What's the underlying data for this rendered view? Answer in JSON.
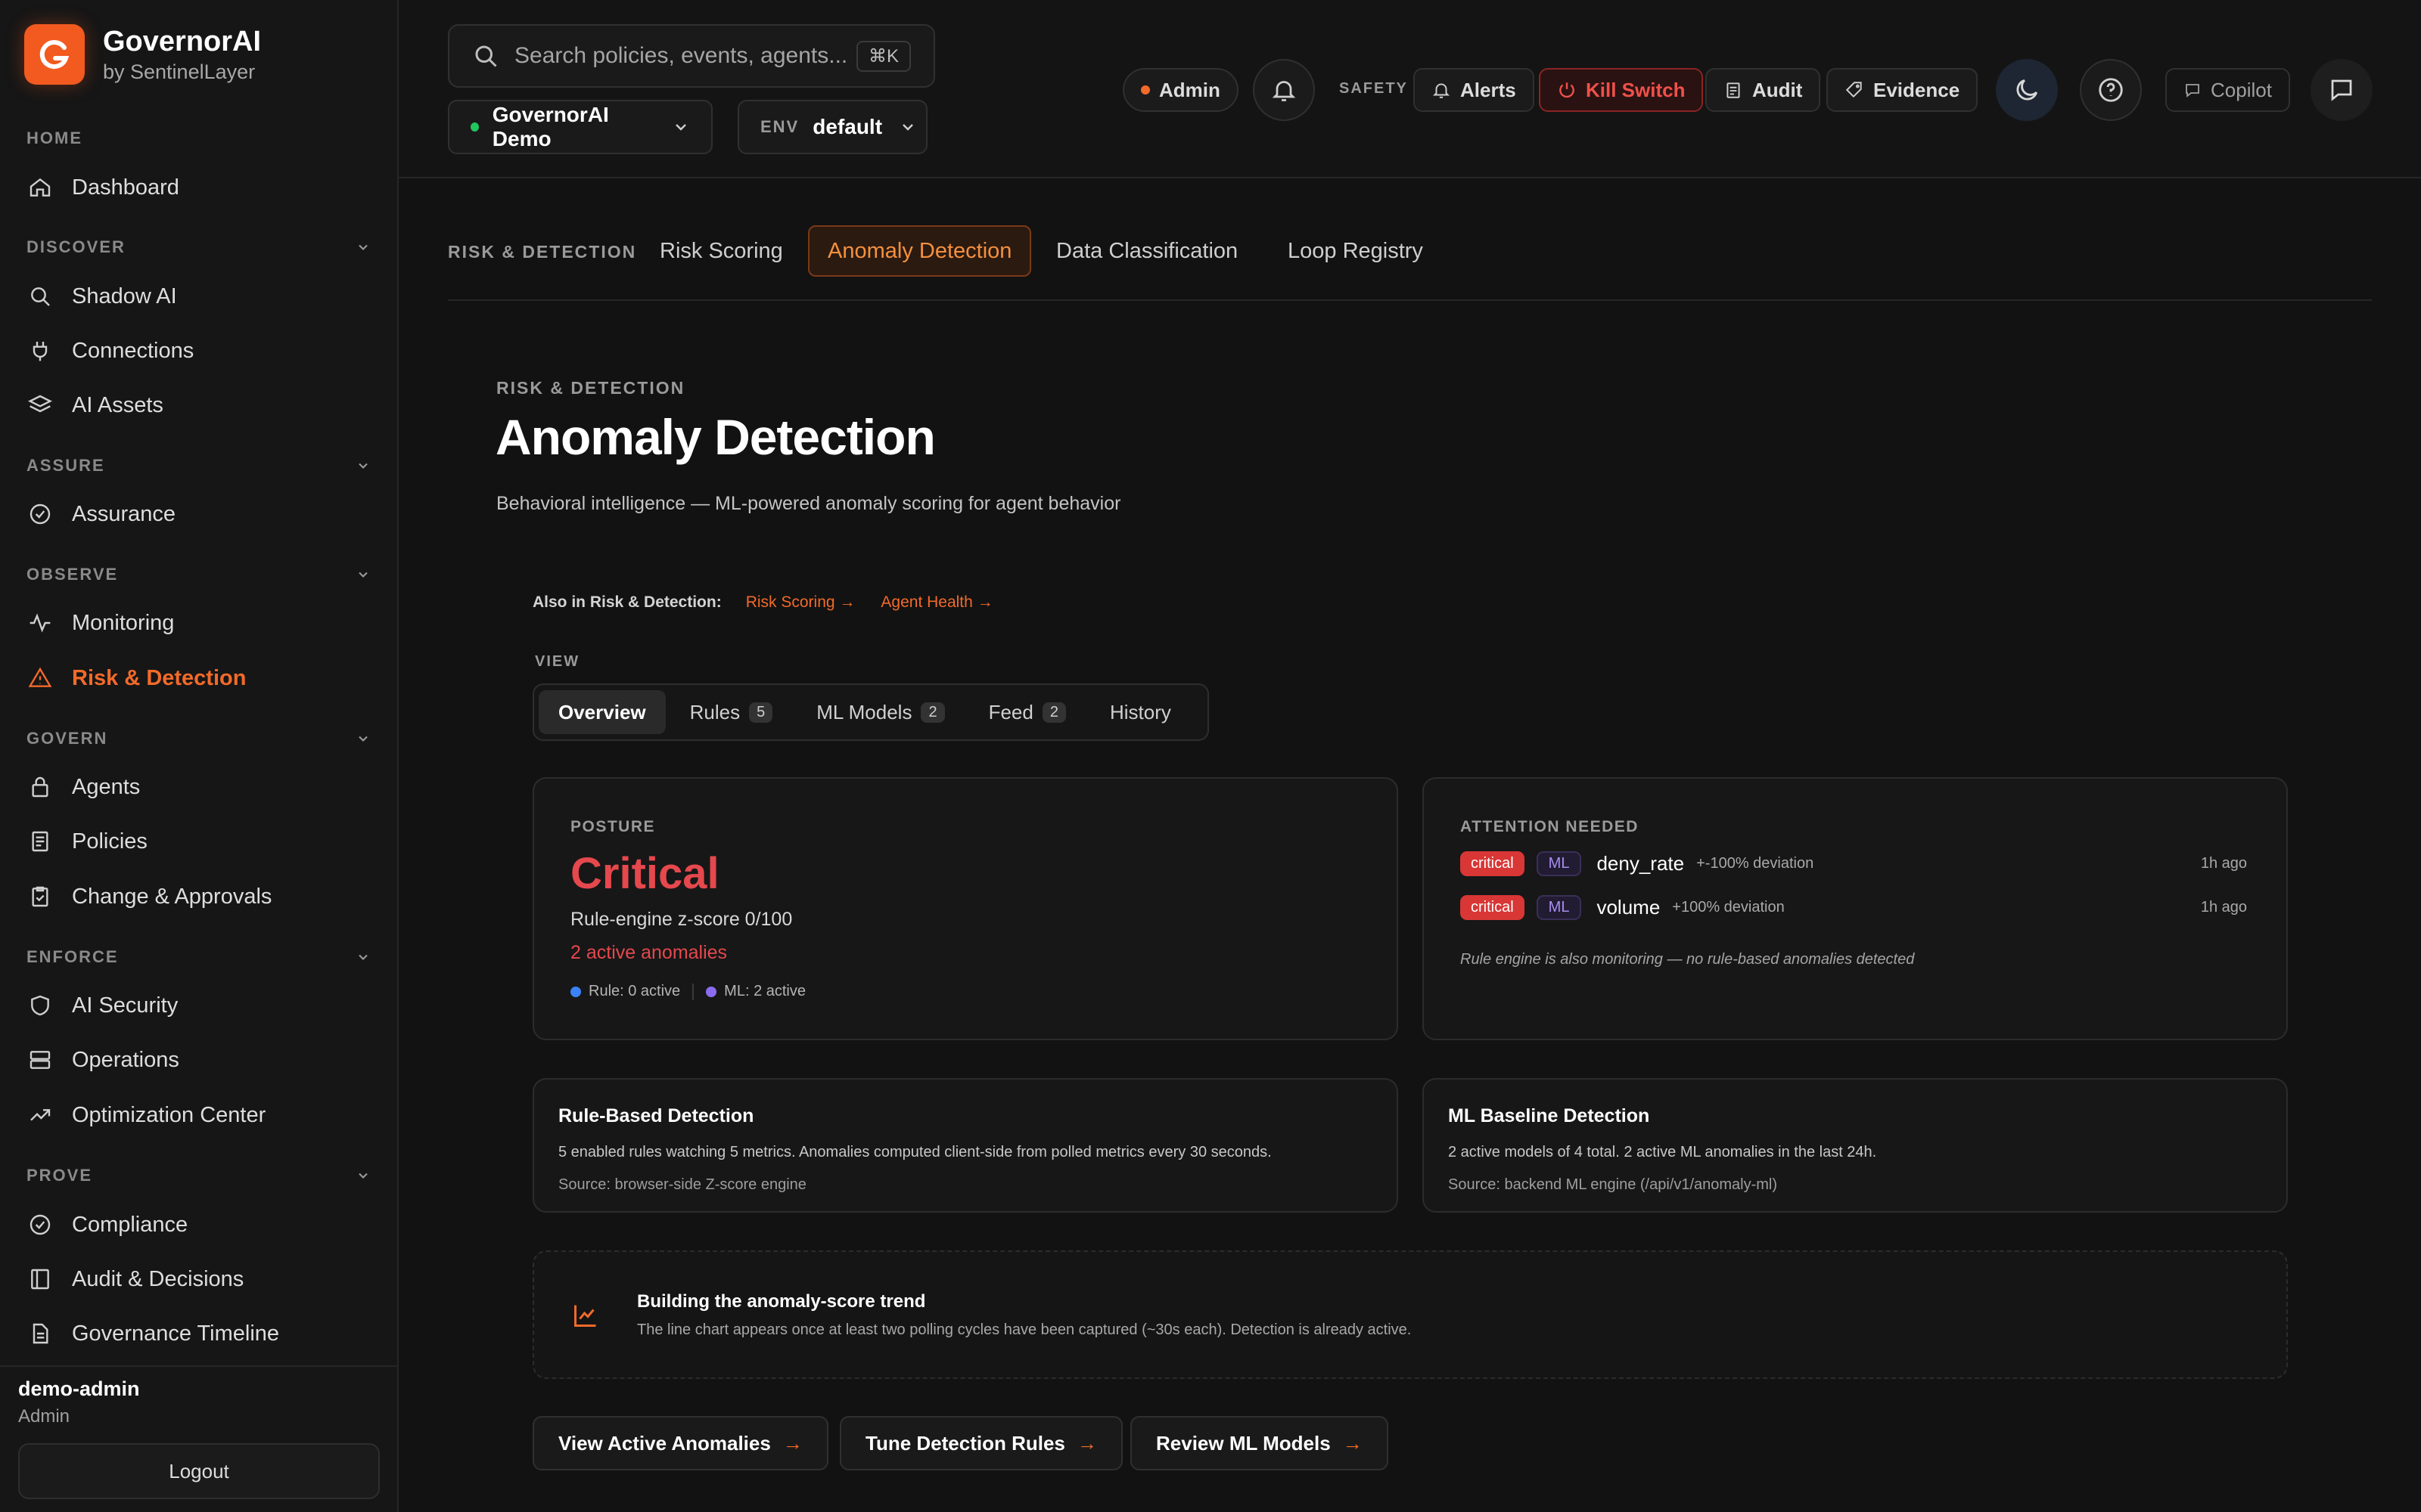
{
  "brand": {
    "name": "GovernorAI",
    "sub": "by SentinelLayer"
  },
  "sidebar": {
    "sections": [
      {
        "head": "HOME",
        "items": [
          "Dashboard"
        ]
      },
      {
        "head": "DISCOVER",
        "items": [
          "Shadow AI",
          "Connections",
          "AI Assets"
        ]
      },
      {
        "head": "ASSURE",
        "items": [
          "Assurance"
        ]
      },
      {
        "head": "OBSERVE",
        "items": [
          "Monitoring",
          "Risk & Detection"
        ]
      },
      {
        "head": "GOVERN",
        "items": [
          "Agents",
          "Policies",
          "Change & Approvals"
        ]
      },
      {
        "head": "ENFORCE",
        "items": [
          "AI Security",
          "Operations",
          "Optimization Center"
        ]
      },
      {
        "head": "PROVE",
        "items": [
          "Compliance",
          "Audit & Decisions",
          "Governance Timeline"
        ]
      }
    ],
    "active_item": "Risk & Detection",
    "user": {
      "name": "demo-admin",
      "role": "Admin"
    },
    "logout_label": "Logout"
  },
  "header": {
    "search_placeholder": "Search policies, events, agents...",
    "search_shortcut": "⌘K",
    "workspace": "GovernorAI Demo",
    "env_label": "ENV",
    "env_value": "default",
    "role_badge": "Admin",
    "safety_label": "SAFETY",
    "alerts_label": "Alerts",
    "kill_switch_label": "Kill Switch",
    "audit_label": "Audit",
    "evidence_label": "Evidence",
    "copilot_label": "Copilot"
  },
  "subnav": {
    "section_label": "RISK & DETECTION",
    "tabs": [
      "Risk Scoring",
      "Anomaly Detection",
      "Data Classification",
      "Loop Registry"
    ],
    "active_tab": "Anomaly Detection"
  },
  "page": {
    "eyebrow": "RISK & DETECTION",
    "title": "Anomaly Detection",
    "subtitle": "Behavioral intelligence — ML-powered anomaly scoring for agent behavior",
    "also_label": "Also in Risk & Detection:",
    "also_links": [
      "Risk Scoring →",
      "Agent Health →"
    ],
    "view_label": "VIEW",
    "view_tabs": [
      {
        "label": "Overview",
        "count": ""
      },
      {
        "label": "Rules",
        "count": "5"
      },
      {
        "label": "ML Models",
        "count": "2"
      },
      {
        "label": "Feed",
        "count": "2"
      },
      {
        "label": "History",
        "count": ""
      }
    ],
    "active_view": "Overview"
  },
  "posture": {
    "eyebrow": "POSTURE",
    "status": "Critical",
    "score_text": "Rule-engine z-score 0/100",
    "active_text": "2 active anomalies",
    "rule_legend": "Rule: 0 active",
    "ml_legend": "ML: 2 active"
  },
  "attention": {
    "eyebrow": "ATTENTION NEEDED",
    "rows": [
      {
        "severity": "critical",
        "source": "ML",
        "metric": "deny_rate",
        "deviation": "+-100% deviation",
        "ago": "1h ago"
      },
      {
        "severity": "critical",
        "source": "ML",
        "metric": "volume",
        "deviation": "+100% deviation",
        "ago": "1h ago"
      }
    ],
    "note": "Rule engine is also monitoring — no rule-based anomalies detected"
  },
  "rule_detection": {
    "title": "Rule-Based Detection",
    "desc": "5 enabled rules watching 5 metrics. Anomalies computed client-side from polled metrics every 30 seconds.",
    "source": "Source: browser-side Z-score engine"
  },
  "ml_detection": {
    "title": "ML Baseline Detection",
    "desc": "2 active models of 4 total. 2 active ML anomalies in the last 24h.",
    "source": "Source: backend ML engine (/api/v1/anomaly-ml)"
  },
  "trend": {
    "title": "Building the anomaly-score trend",
    "desc": "The line chart appears once at least two polling cycles have been captured (~30s each). Detection is already active."
  },
  "actions": [
    "View Active Anomalies",
    "Tune Detection Rules",
    "Review ML Models"
  ],
  "colors": {
    "accent": "#f26a2a",
    "critical": "#e5484d",
    "ml": "#8b6cf0",
    "rule": "#3b82f6"
  }
}
